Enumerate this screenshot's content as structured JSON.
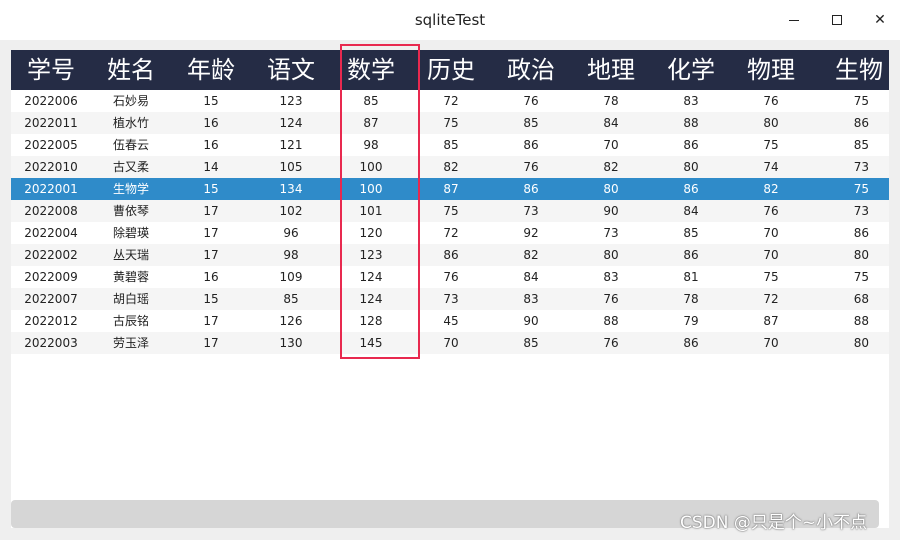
{
  "window": {
    "title": "sqliteTest",
    "minimize_icon": "minimize-icon",
    "maximize_icon": "maximize-icon",
    "close_icon": "close-icon",
    "close_glyph": "✕"
  },
  "table": {
    "headers": [
      "学号",
      "姓名",
      "年龄",
      "语文",
      "数学",
      "历史",
      "政治",
      "地理",
      "化学",
      "物理",
      "生物"
    ],
    "selected_row": 4,
    "highlighted_column": "数学",
    "colors": {
      "header_bg": "#252c45",
      "selected_bg": "#2f8bc9",
      "highlight_border": "#e8294f"
    },
    "rows": [
      [
        "2022006",
        "石妙易",
        "15",
        "123",
        "85",
        "72",
        "76",
        "78",
        "83",
        "76",
        "75"
      ],
      [
        "2022011",
        "植水竹",
        "16",
        "124",
        "87",
        "75",
        "85",
        "84",
        "88",
        "80",
        "86"
      ],
      [
        "2022005",
        "伍春云",
        "16",
        "121",
        "98",
        "85",
        "86",
        "70",
        "86",
        "75",
        "85"
      ],
      [
        "2022010",
        "古又柔",
        "14",
        "105",
        "100",
        "82",
        "76",
        "82",
        "80",
        "74",
        "73"
      ],
      [
        "2022001",
        "生物学",
        "15",
        "134",
        "100",
        "87",
        "86",
        "80",
        "86",
        "82",
        "75"
      ],
      [
        "2022008",
        "曹依琴",
        "17",
        "102",
        "101",
        "75",
        "73",
        "90",
        "84",
        "76",
        "73"
      ],
      [
        "2022004",
        "除碧瑛",
        "17",
        "96",
        "120",
        "72",
        "92",
        "73",
        "85",
        "70",
        "86"
      ],
      [
        "2022002",
        "丛天瑞",
        "17",
        "98",
        "123",
        "86",
        "82",
        "80",
        "86",
        "70",
        "80"
      ],
      [
        "2022009",
        "黄碧蓉",
        "16",
        "109",
        "124",
        "76",
        "84",
        "83",
        "81",
        "75",
        "75"
      ],
      [
        "2022007",
        "胡白瑶",
        "15",
        "85",
        "124",
        "73",
        "83",
        "76",
        "78",
        "72",
        "68"
      ],
      [
        "2022012",
        "古辰铭",
        "17",
        "126",
        "128",
        "45",
        "90",
        "88",
        "79",
        "87",
        "88"
      ],
      [
        "2022003",
        "劳玉泽",
        "17",
        "130",
        "145",
        "70",
        "85",
        "76",
        "86",
        "70",
        "80"
      ]
    ]
  },
  "watermark": "CSDN @只是个~小不点"
}
